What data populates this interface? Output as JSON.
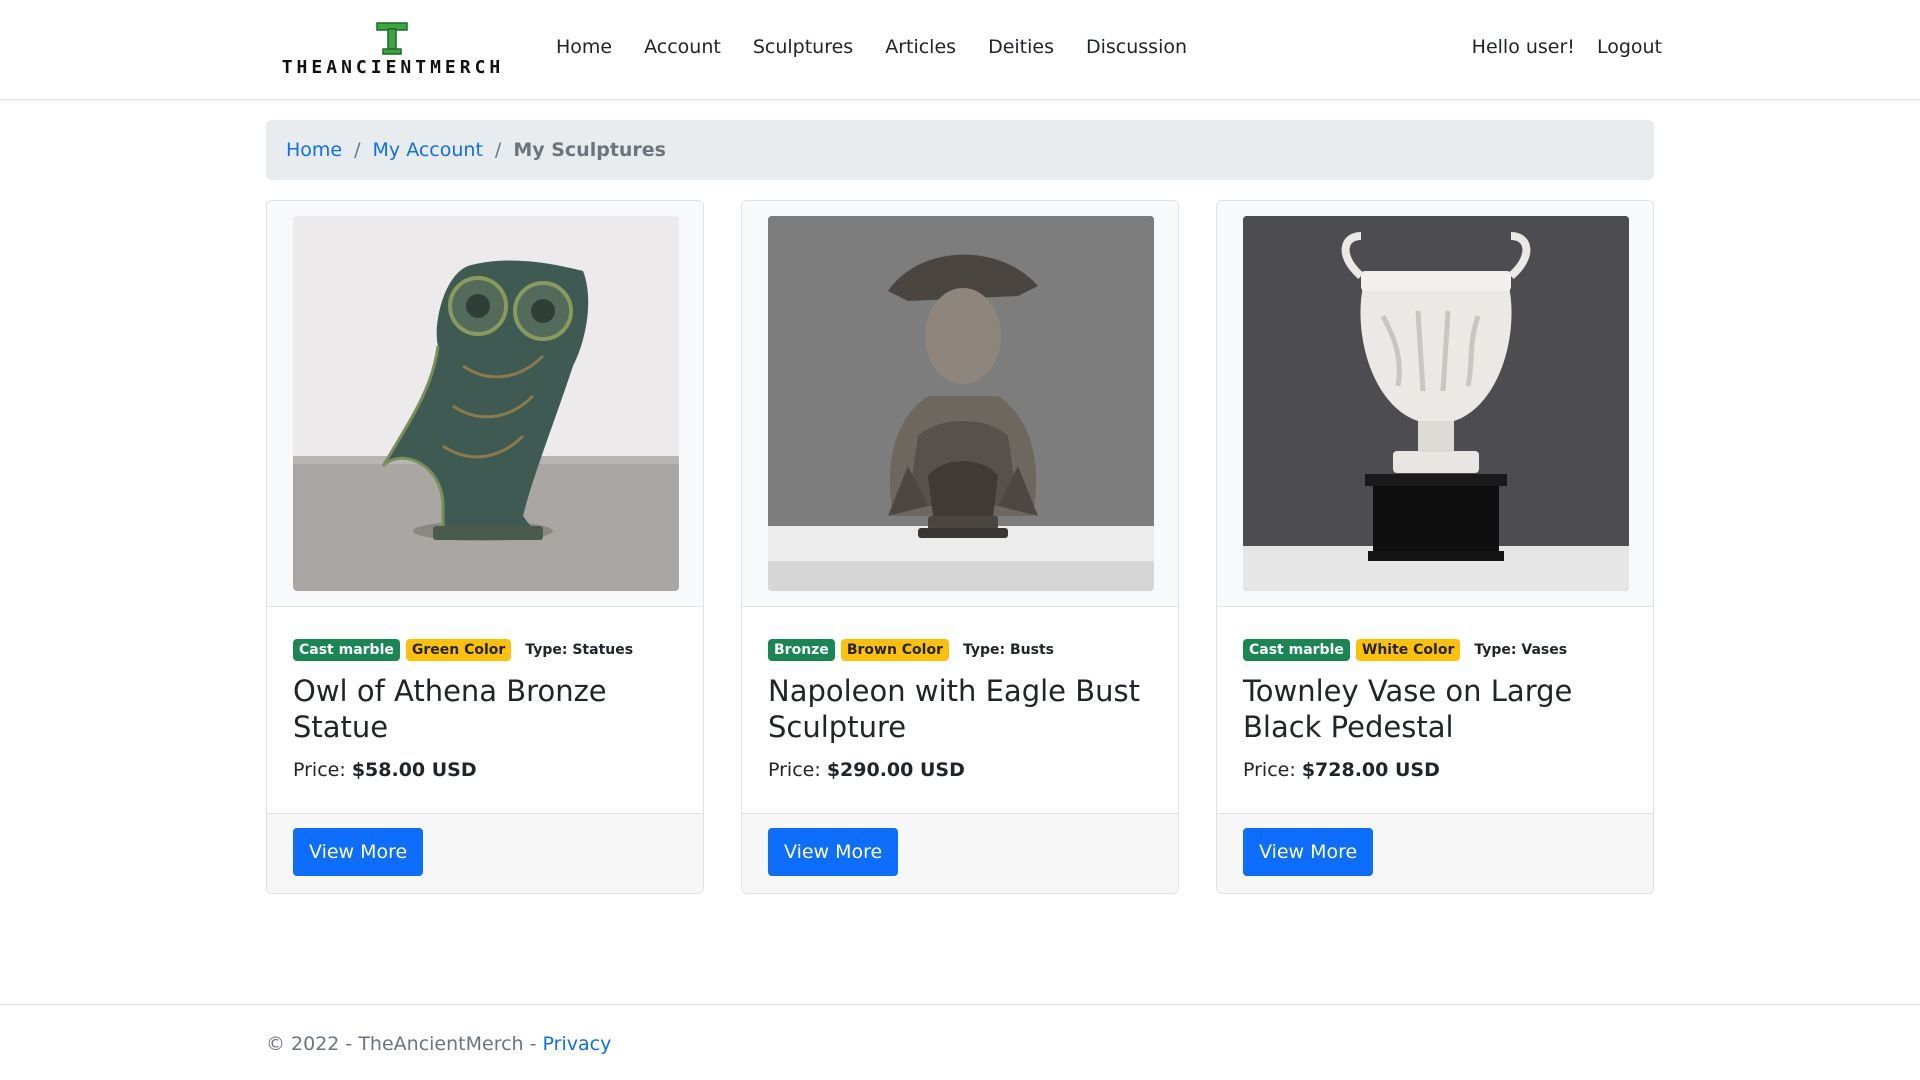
{
  "brand": {
    "logo_letter": "T",
    "logo_text": "THEANCIENTMERCH",
    "logo_color": "#3aa63f"
  },
  "nav": {
    "items": [
      {
        "label": "Home"
      },
      {
        "label": "Account"
      },
      {
        "label": "Sculptures"
      },
      {
        "label": "Articles"
      },
      {
        "label": "Deities"
      },
      {
        "label": "Discussion"
      }
    ],
    "greeting": "Hello user!",
    "logout": "Logout"
  },
  "breadcrumb": {
    "home": "Home",
    "separator": "/",
    "account": "My Account",
    "current": "My Sculptures"
  },
  "products": [
    {
      "material": "Cast marble",
      "color": "Green Color",
      "type": "Type: Statues",
      "title": "Owl of Athena Bronze Statue",
      "price_label": "Price:",
      "price": "$58.00 USD",
      "button": "View More",
      "image_icon": "owl-statue-image"
    },
    {
      "material": "Bronze",
      "color": "Brown Color",
      "type": "Type: Busts",
      "title": "Napoleon with Eagle Bust Sculpture",
      "price_label": "Price:",
      "price": "$290.00 USD",
      "button": "View More",
      "image_icon": "napoleon-bust-image"
    },
    {
      "material": "Cast marble",
      "color": "White Color",
      "type": "Type: Vases",
      "title": "Townley Vase on Large Black Pedestal",
      "price_label": "Price:",
      "price": "$728.00 USD",
      "button": "View More",
      "image_icon": "townley-vase-image"
    }
  ],
  "footer": {
    "copyright": "© 2022 - TheAncientMerch - ",
    "privacy": "Privacy"
  },
  "colors": {
    "primary": "#0d6efd",
    "success": "#198754",
    "warning": "#ffc107",
    "breadcrumb_bg": "#e9ecef"
  }
}
